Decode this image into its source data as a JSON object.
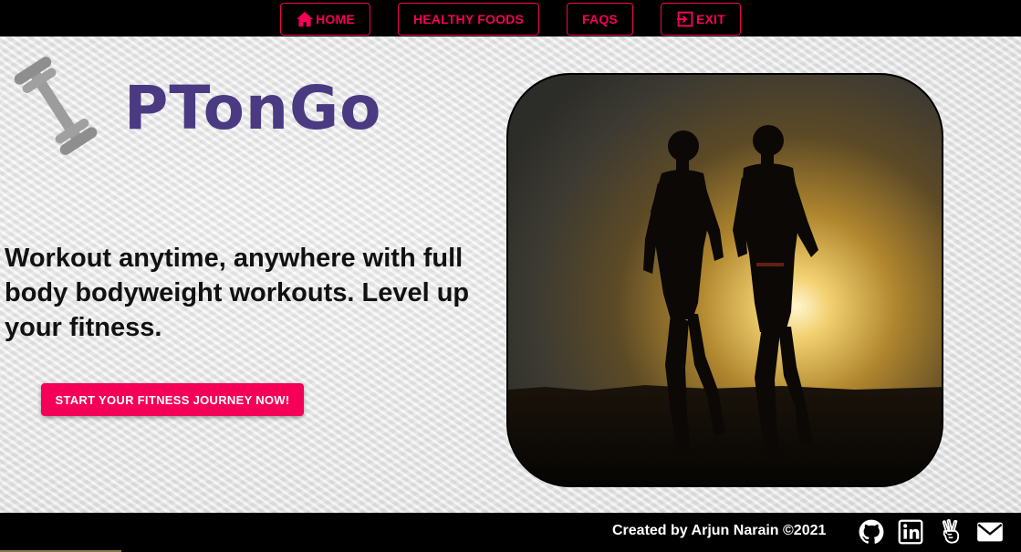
{
  "nav": {
    "home_label": "HOME",
    "healthy_foods_label": "HEALTHY FOODS",
    "faqs_label": "FAQS",
    "exit_label": "EXIT"
  },
  "hero": {
    "brand": "PTonGo",
    "tagline": "Workout anytime, anywhere with full body bodyweight workouts. Level up your fitness.",
    "cta_label": "START YOUR FITNESS JOURNEY NOW!"
  },
  "footer": {
    "credit": "Created by Arjun Narain ©2021",
    "links": [
      "github-icon",
      "linkedin-icon",
      "angellist-icon",
      "email-icon"
    ]
  },
  "colors": {
    "accent": "#f50057",
    "brand": "#4a3a82",
    "bar": "#000000"
  }
}
